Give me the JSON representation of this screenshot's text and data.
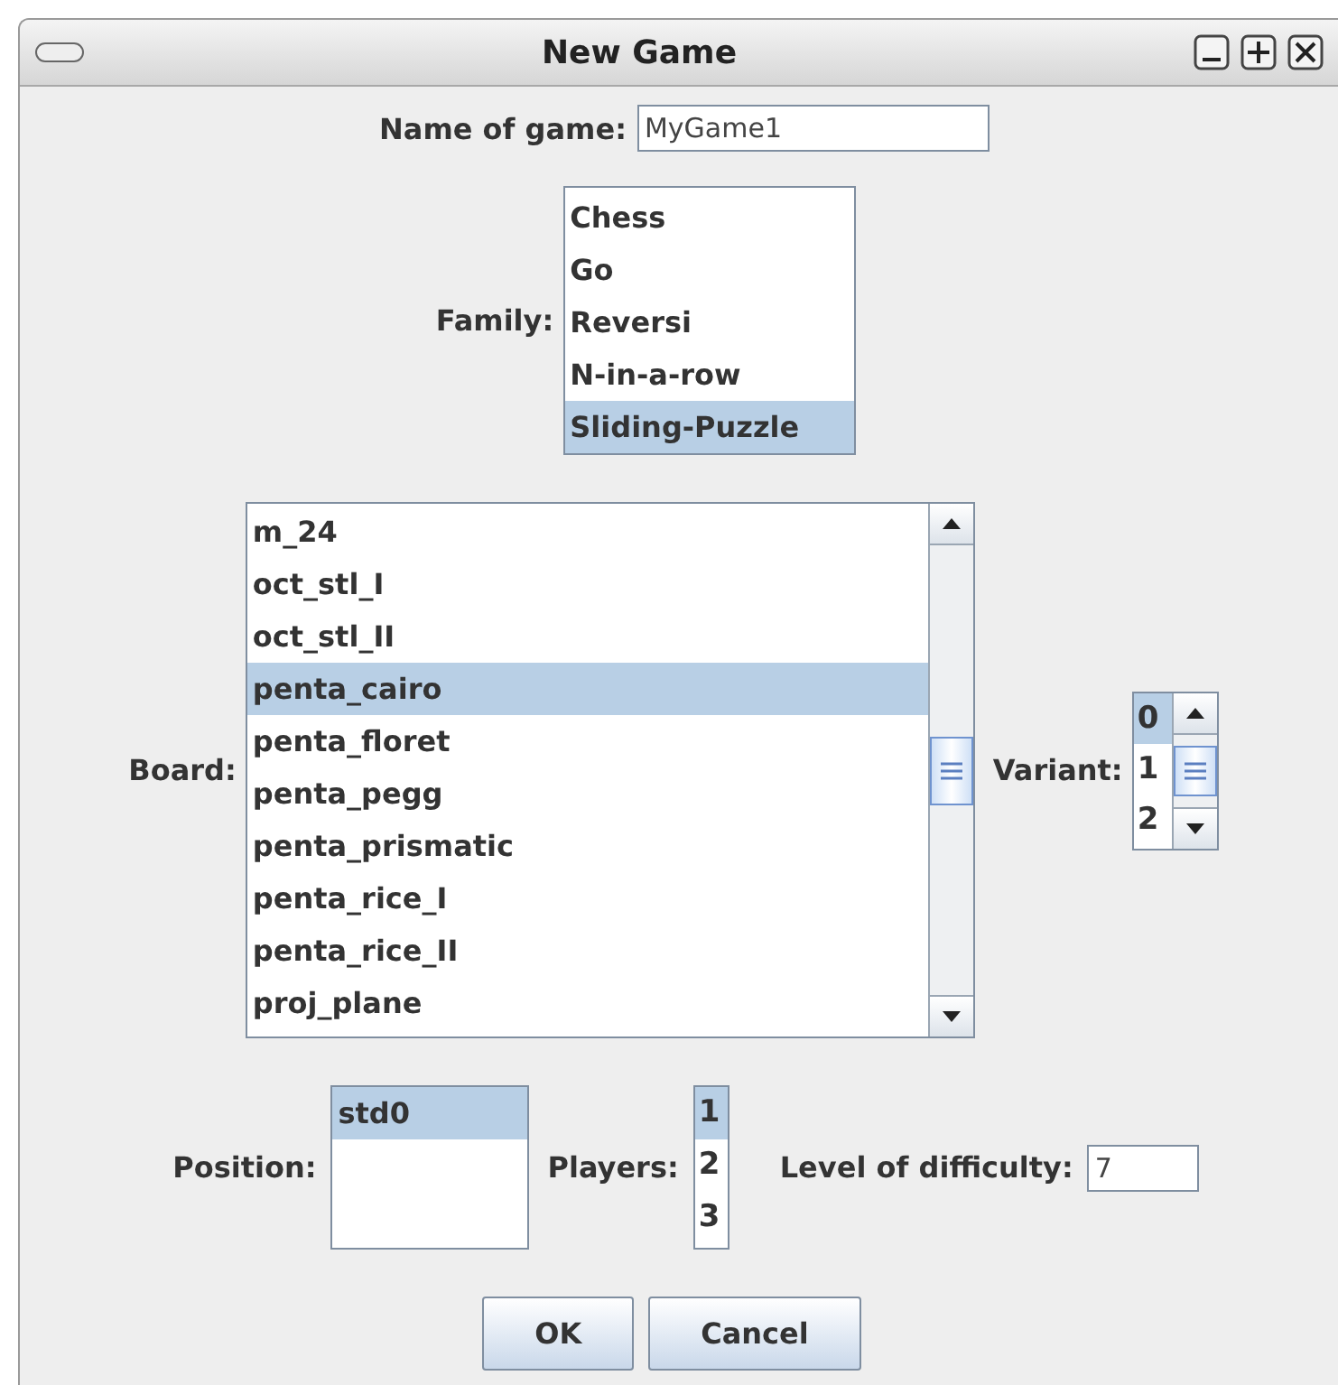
{
  "window": {
    "title": "New Game"
  },
  "name_field": {
    "label": "Name of game:",
    "value": "MyGame1"
  },
  "family": {
    "label": "Family:",
    "items": [
      {
        "label": "Chess",
        "selected": false
      },
      {
        "label": "Go",
        "selected": false
      },
      {
        "label": "Reversi",
        "selected": false
      },
      {
        "label": "N-in-a-row",
        "selected": false
      },
      {
        "label": "Sliding-Puzzle",
        "selected": true
      }
    ]
  },
  "board": {
    "label": "Board:",
    "items": [
      {
        "label": "m_24",
        "selected": false
      },
      {
        "label": "oct_stl_I",
        "selected": false
      },
      {
        "label": "oct_stl_II",
        "selected": false
      },
      {
        "label": "penta_cairo",
        "selected": true
      },
      {
        "label": "penta_floret",
        "selected": false
      },
      {
        "label": "penta_pegg",
        "selected": false
      },
      {
        "label": "penta_prismatic",
        "selected": false
      },
      {
        "label": "penta_rice_I",
        "selected": false
      },
      {
        "label": "penta_rice_II",
        "selected": false
      },
      {
        "label": "proj_plane",
        "selected": false
      }
    ]
  },
  "variant": {
    "label": "Variant:",
    "items": [
      {
        "label": "0",
        "selected": true
      },
      {
        "label": "1",
        "selected": false
      },
      {
        "label": "2",
        "selected": false
      }
    ]
  },
  "position": {
    "label": "Position:",
    "items": [
      {
        "label": "std0",
        "selected": true
      }
    ]
  },
  "players": {
    "label": "Players:",
    "items": [
      {
        "label": "1",
        "selected": true
      },
      {
        "label": "2",
        "selected": false
      },
      {
        "label": "3",
        "selected": false
      }
    ]
  },
  "difficulty": {
    "label": "Level of difficulty:",
    "value": "7"
  },
  "buttons": [
    "OK",
    "Cancel"
  ]
}
